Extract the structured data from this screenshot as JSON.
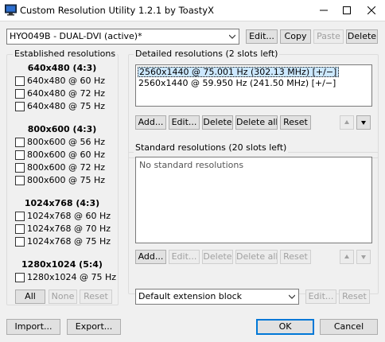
{
  "window": {
    "title": "Custom Resolution Utility 1.2.1 by ToastyX"
  },
  "monitor_bar": {
    "selected": "HYO049B - DUAL-DVI (active)*",
    "edit": "Edit...",
    "copy": "Copy",
    "paste": "Paste",
    "delete": "Delete"
  },
  "established": {
    "label": "Established resolutions",
    "groups": [
      {
        "title": "640x480 (4:3)",
        "items": [
          "640x480 @ 60 Hz",
          "640x480 @ 72 Hz",
          "640x480 @ 75 Hz"
        ]
      },
      {
        "title": "800x600 (4:3)",
        "items": [
          "800x600 @ 56 Hz",
          "800x600 @ 60 Hz",
          "800x600 @ 72 Hz",
          "800x600 @ 75 Hz"
        ]
      },
      {
        "title": "1024x768 (4:3)",
        "items": [
          "1024x768 @ 60 Hz",
          "1024x768 @ 70 Hz",
          "1024x768 @ 75 Hz"
        ]
      },
      {
        "title": "1280x1024 (5:4)",
        "items": [
          "1280x1024 @ 75 Hz"
        ]
      }
    ],
    "all": "All",
    "none": "None",
    "reset": "Reset"
  },
  "detailed": {
    "label": "Detailed resolutions (2 slots left)",
    "rows": [
      "2560x1440 @ 75.001 Hz (302.13 MHz) [+/−]",
      "2560x1440 @ 59.950 Hz (241.50 MHz) [+/−]"
    ],
    "add": "Add...",
    "edit": "Edit...",
    "delete": "Delete",
    "delete_all": "Delete all",
    "reset": "Reset"
  },
  "standard": {
    "label": "Standard resolutions (20 slots left)",
    "empty": "No standard resolutions",
    "add": "Add...",
    "edit": "Edit...",
    "delete": "Delete",
    "delete_all": "Delete all",
    "reset": "Reset"
  },
  "extension": {
    "selected": "Default extension block",
    "edit": "Edit...",
    "reset": "Reset"
  },
  "footer": {
    "import": "Import...",
    "export": "Export...",
    "ok": "OK",
    "cancel": "Cancel"
  },
  "colors": {
    "accent": "#0078d7",
    "selection": "#cce8ff"
  }
}
